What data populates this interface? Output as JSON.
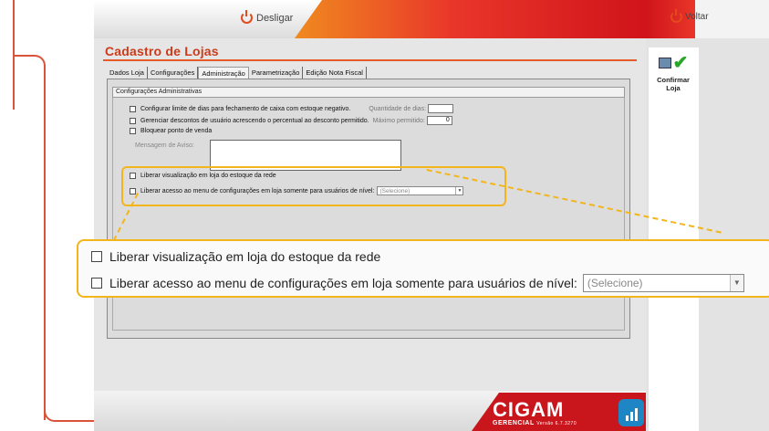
{
  "header": {
    "desligar_label": "Desligar",
    "voltar_label": "Voltar"
  },
  "page": {
    "title": "Cadastro de Lojas"
  },
  "tabs": [
    {
      "label": "Dados Loja"
    },
    {
      "label": "Configurações"
    },
    {
      "label": "Administração"
    },
    {
      "label": "Parametrização"
    },
    {
      "label": "Edição Nota Fiscal"
    }
  ],
  "panel": {
    "heading": "Configurações Administrativas",
    "options": [
      {
        "label": "Configurar limite de dias para fechamento de caixa com estoque negativo.",
        "field_label": "Quantidade de dias:",
        "field_value": ""
      },
      {
        "label": "Gerenciar descontos de usuário acrescendo o percentual ao desconto permitido.",
        "field_label": "Máximo permitido:",
        "field_value": "0"
      },
      {
        "label": "Bloquear ponto de venda"
      }
    ],
    "message_label": "Mensagem de Aviso:",
    "highlighted_options": [
      {
        "label": "Liberar visualização em loja do estoque da rede"
      },
      {
        "label": "Liberar acesso ao menu de configurações em loja somente para usuários de nível:",
        "select_value": "(Selecione)"
      }
    ]
  },
  "sidebar": {
    "confirm_label": "Confirmar Loja"
  },
  "callout": {
    "option1": "Liberar visualização em loja do estoque da rede",
    "option2": "Liberar acesso ao menu de configurações em loja somente para usuários de nível:",
    "select_value": "(Selecione)"
  },
  "footer": {
    "brand": "CIGAM",
    "subtitle": "GERENCIAL",
    "version": "Versão 6.7.3270"
  }
}
